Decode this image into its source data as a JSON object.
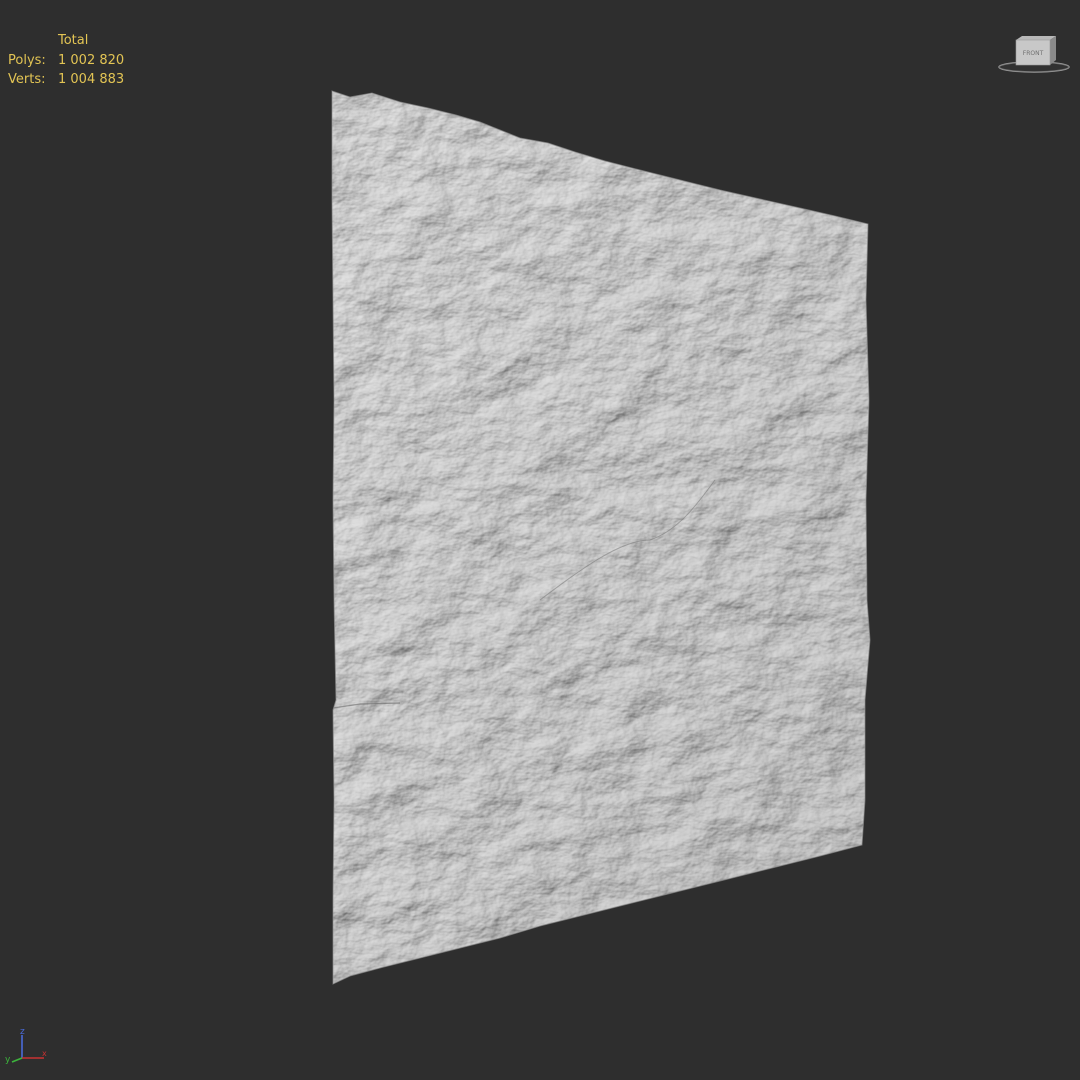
{
  "stats": {
    "header": "Total",
    "polys_label": "Polys:",
    "polys_value": "1 002 820",
    "verts_label": "Verts:",
    "verts_value": "1 004 883"
  },
  "viewcube": {
    "face_label": "FRONT"
  },
  "axis": {
    "x_label": "x",
    "y_label": "y",
    "z_label": "z",
    "x_color": "#c83232",
    "y_color": "#3cb43c",
    "z_color": "#4a6ad8"
  },
  "colors": {
    "viewport_bg": "#2e2e2e",
    "stats_text": "#e2c454",
    "mesh_base": "#a6a6a6"
  },
  "icons": {
    "viewcube": "viewcube-icon",
    "axis": "axis-tripod-icon"
  }
}
